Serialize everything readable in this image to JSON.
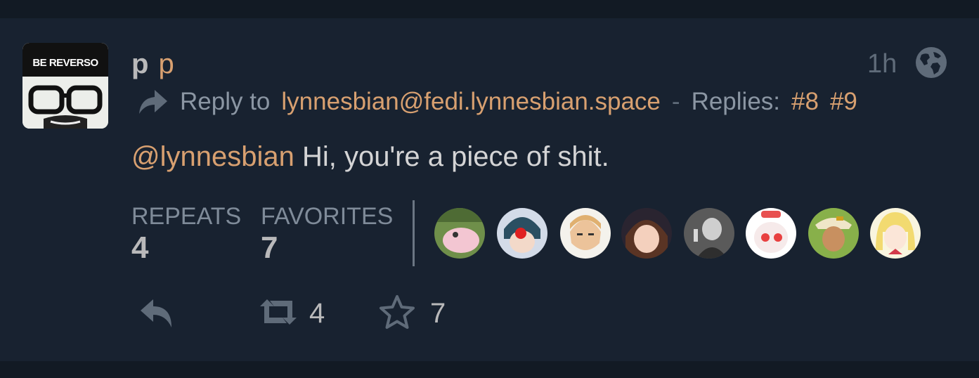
{
  "status": {
    "avatar_label": "BE REVERSO",
    "display_name": "p",
    "account_name": "p",
    "time": "1h",
    "reply_to_label": "Reply to",
    "reply_to_user": "lynnesbian@fedi.lynnesbian.space",
    "separator": "-",
    "replies_label": "Replies:",
    "replies": [
      "#8",
      "#9"
    ],
    "mention": "@lynnesbian",
    "text": " Hi, you're a piece of shit.",
    "repeats_label": "REPEATS",
    "repeats_count": "4",
    "favorites_label": "FAVORITES",
    "favorites_count": "7",
    "favoriters": [
      {
        "bg": "#b8c98a",
        "fg": "#f0c4cf"
      },
      {
        "bg": "#cfd7e4",
        "fg": "#2f5366"
      },
      {
        "bg": "#f2efe8",
        "fg": "#d6a577"
      },
      {
        "bg": "#3a2a2e",
        "fg": "#f0c8b0"
      },
      {
        "bg": "#6a6a6a",
        "fg": "#c6c6c6"
      },
      {
        "bg": "#ffffff",
        "fg": "#e86a6a"
      },
      {
        "bg": "#8ab04e",
        "fg": "#c8a070"
      },
      {
        "bg": "#f7f1d2",
        "fg": "#f4d96a"
      }
    ],
    "action_repeat_count": "4",
    "action_favorite_count": "7"
  },
  "colors": {
    "page_bg": "#121a24",
    "card_bg": "#182230",
    "accent": "#d8a070",
    "icon": "#5f6b79"
  }
}
